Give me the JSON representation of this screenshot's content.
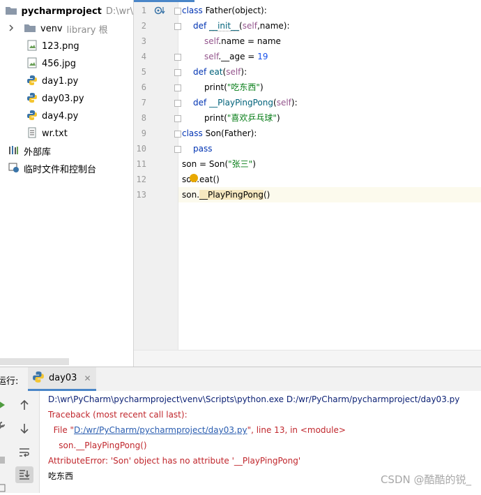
{
  "project": {
    "root_name": "pycharmproject",
    "root_path": "D:\\wr\\",
    "items": [
      {
        "name": "venv",
        "note": "library 根",
        "kind": "folder"
      },
      {
        "name": "123.png",
        "kind": "image"
      },
      {
        "name": "456.jpg",
        "kind": "image"
      },
      {
        "name": "day1.py",
        "kind": "python"
      },
      {
        "name": "day03.py",
        "kind": "python"
      },
      {
        "name": "day4.py",
        "kind": "python"
      },
      {
        "name": "wr.txt",
        "kind": "text"
      },
      {
        "name": "外部库",
        "kind": "library"
      },
      {
        "name": "临时文件和控制台",
        "kind": "scratch"
      }
    ]
  },
  "editor": {
    "line_numbers": [
      "1",
      "2",
      "3",
      "4",
      "5",
      "6",
      "7",
      "8",
      "9",
      "10",
      "11",
      "12",
      "13"
    ],
    "lines": {
      "l1_kw": "class",
      "l1_rest": " Father(object):",
      "l2_kw": "def",
      "l2_fn": "__init__",
      "l2_open": "(",
      "l2_self": "self",
      "l2_rest": ",name):",
      "l3_self": "self",
      "l3_rest": ".name = name",
      "l4_self": "self",
      "l4_mid": ".__age = ",
      "l4_num": "19",
      "l5_kw": "def",
      "l5_fn": "eat",
      "l5_open": "(",
      "l5_self": "self",
      "l5_close": "):",
      "l6_call": "print(",
      "l6_str": "\"吃东西\"",
      "l6_close": ")",
      "l7_kw": "def",
      "l7_fn": "__PlayPingPong",
      "l7_open": "(",
      "l7_self": "self",
      "l7_close": "):",
      "l8_call": "print(",
      "l8_str": "\"喜欢乒乓球\"",
      "l8_close": ")",
      "l9_kw": "class",
      "l9_rest": " Son(Father):",
      "l10_kw": "pass",
      "l11_pre": "son = Son(",
      "l11_str": "\"张三\"",
      "l11_close": ")",
      "l12_a": "so",
      "l12_b": "n.eat()",
      "l13_pre": "son.",
      "l13_hl": "__PlayPingPong",
      "l13_close": "()"
    }
  },
  "run": {
    "label": "运行:",
    "tab_label": "day03",
    "tab_close": "✕"
  },
  "console": {
    "cmd": "D:\\wr\\PyCharm\\pycharmproject\\venv\\Scripts\\python.exe D:/wr/PyCharm/pycharmproject/day03.py",
    "traceback": "Traceback (most recent call last):",
    "file_pre": "  File \"",
    "file_link": "D:/wr/PyCharm/pycharmproject/day03.py",
    "file_post": "\", line 13, in <module>",
    "code": "    son.__PlayPingPong()",
    "error": "AttributeError: 'Son' object has no attribute '__PlayPingPong'",
    "output": "吃东西"
  },
  "watermark": "CSDN @酷酷的锐_"
}
